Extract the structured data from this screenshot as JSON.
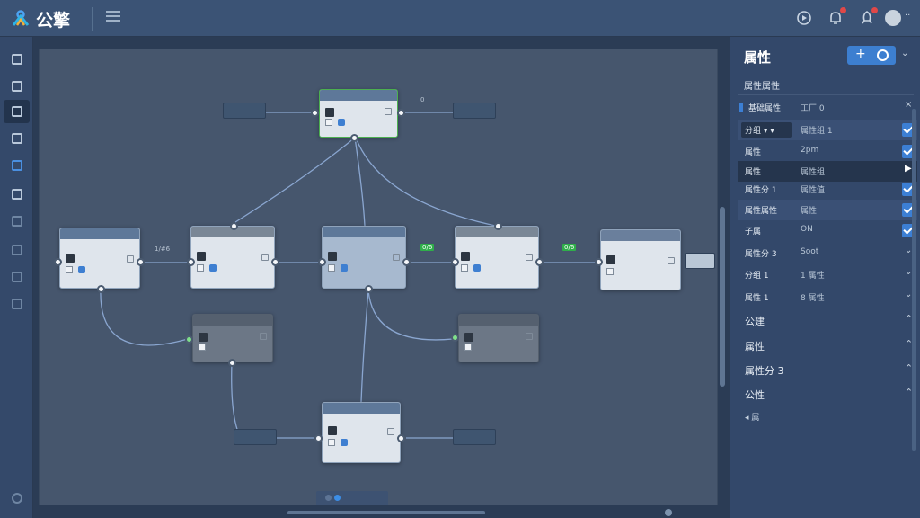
{
  "app": {
    "title": "公擎"
  },
  "colors": {
    "accent": "#3c7fd4",
    "topbar": "#3b5375",
    "canvas": "#46566d",
    "selected_border": "#4caf50",
    "badge": "#e04848"
  },
  "topbar": {
    "icons": [
      "logo-icon",
      "menu-icon",
      "record-icon",
      "bell-icon",
      "rocket-icon",
      "avatar"
    ]
  },
  "rail": {
    "icons": [
      "grid-icon",
      "layout-icon",
      "cube-icon",
      "nodes-icon",
      "chart-icon",
      "package-icon",
      "network-icon",
      "list-icon",
      "share-icon",
      "share-alt-icon",
      "settings-icon"
    ]
  },
  "canvas": {
    "chips": {
      "left_top": "",
      "right_top": "",
      "mid_label_1": "1/#6",
      "mid_label_2": "0/6",
      "mid_label_3": "0/6",
      "top_right_tag": "0"
    }
  },
  "panel": {
    "title": "属性",
    "section": "属性属性",
    "rows": [
      {
        "label": "基础属性",
        "value": "工厂 0",
        "control": "text"
      },
      {
        "label": "分组 ▾ ▾",
        "value": "属性组 1",
        "control": "check"
      },
      {
        "label": "属性",
        "value": "2pm",
        "control": "check"
      },
      {
        "label": "属性",
        "value": "属性组",
        "control": "play"
      },
      {
        "label": "属性分 1",
        "value": "属性值",
        "control": "check"
      },
      {
        "label": "属性属性",
        "value": "属性",
        "control": "check"
      },
      {
        "label": "子属",
        "value": "ON",
        "control": "check"
      },
      {
        "label": "属性分 3",
        "value": "Soot",
        "control": "chevron"
      },
      {
        "label": "分组 1",
        "value": "1 属性",
        "control": "chevron"
      },
      {
        "label": "属性 1",
        "value": "8 属性",
        "control": "chevron"
      }
    ],
    "groups": [
      {
        "label": "公建",
        "expanded": true
      },
      {
        "label": "属性",
        "expanded": true
      },
      {
        "label": "属性分 3",
        "expanded": true
      },
      {
        "label": "公性",
        "expanded": true
      }
    ],
    "footer": "◂ 属"
  }
}
